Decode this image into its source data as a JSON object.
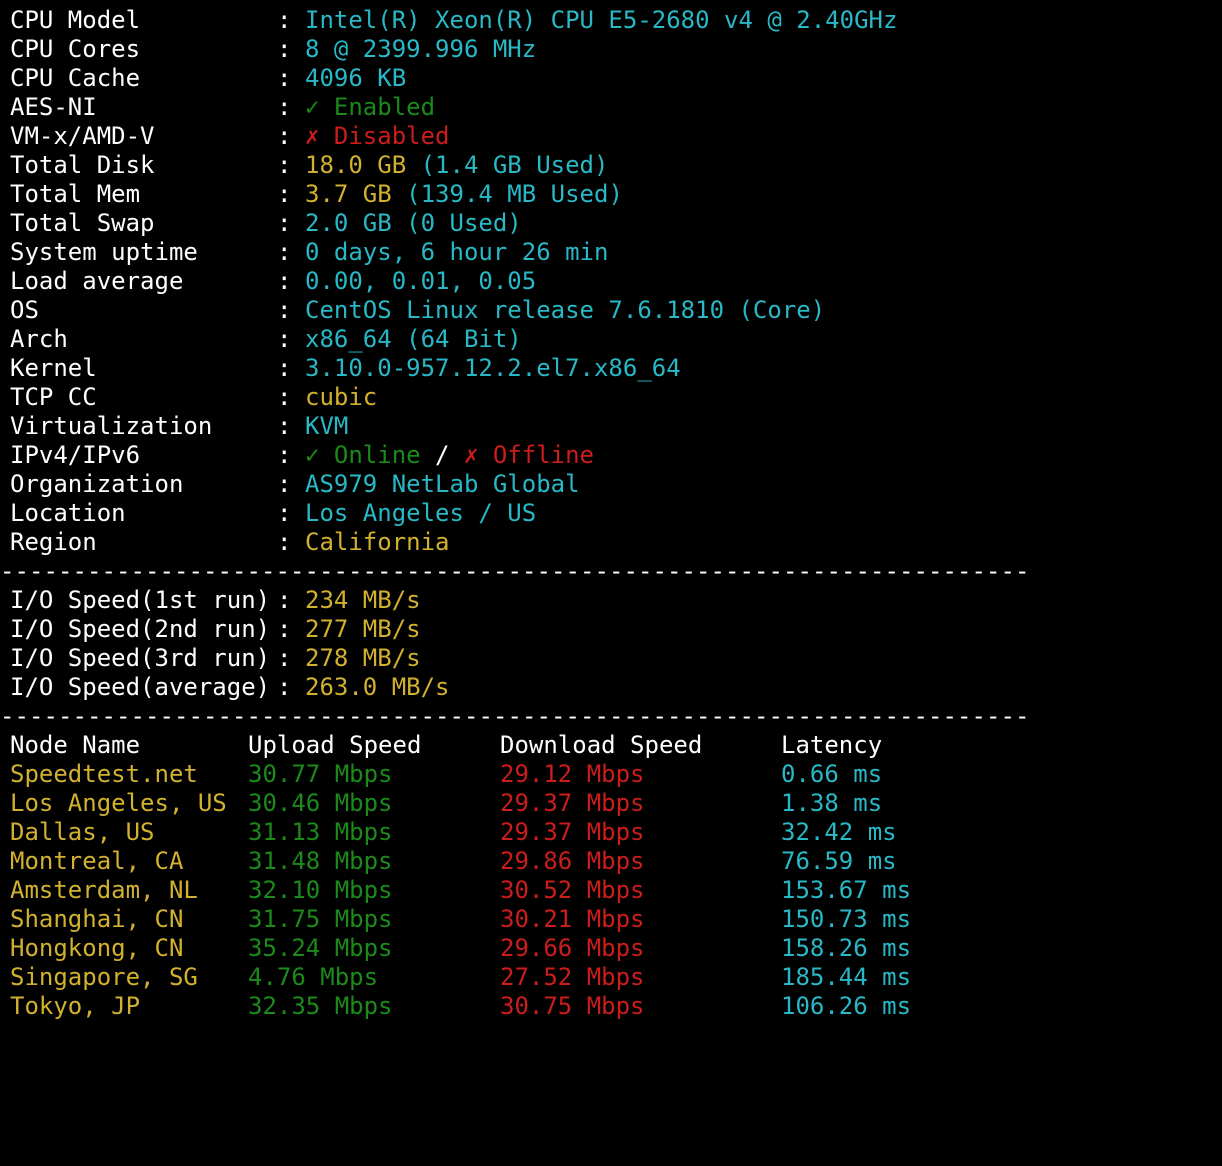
{
  "colors": {
    "background": "#000000",
    "label": "#ffffff",
    "cyan": "#29b8c6",
    "yellow": "#d1b12e",
    "green": "#1b8a1b",
    "red": "#cc1d1d"
  },
  "system_info": {
    "colon": ":",
    "rows": [
      {
        "label": "CPU Model",
        "value": "Intel(R) Xeon(R) CPU E5-2680 v4 @ 2.40GHz",
        "color": "cyan"
      },
      {
        "label": "CPU Cores",
        "value": "8 @ 2399.996 MHz",
        "color": "cyan"
      },
      {
        "label": "CPU Cache",
        "value": "4096 KB",
        "color": "cyan"
      },
      {
        "label": "AES-NI",
        "value": "✓ Enabled",
        "color": "green"
      },
      {
        "label": "VM-x/AMD-V",
        "value": "✗ Disabled",
        "color": "red"
      },
      {
        "label": "Total Disk",
        "value": "18.0 GB",
        "value_suffix": " (1.4 GB Used)",
        "color": "yellow",
        "suffix_color": "cyan"
      },
      {
        "label": "Total Mem",
        "value": "3.7 GB",
        "value_suffix": " (139.4 MB Used)",
        "color": "yellow",
        "suffix_color": "cyan"
      },
      {
        "label": "Total Swap",
        "value": "2.0 GB (0 Used)",
        "color": "cyan"
      },
      {
        "label": "System uptime",
        "value": "0 days, 6 hour 26 min",
        "color": "cyan"
      },
      {
        "label": "Load average",
        "value": "0.00, 0.01, 0.05",
        "color": "cyan"
      },
      {
        "label": "OS",
        "value": "CentOS Linux release 7.6.1810 (Core)",
        "color": "cyan"
      },
      {
        "label": "Arch",
        "value": "x86_64 (64 Bit)",
        "color": "cyan"
      },
      {
        "label": "Kernel",
        "value": "3.10.0-957.12.2.el7.x86_64",
        "color": "cyan"
      },
      {
        "label": "TCP CC",
        "value": "cubic",
        "color": "yellow"
      },
      {
        "label": "Virtualization",
        "value": "KVM",
        "color": "cyan"
      },
      {
        "label": "IPv4/IPv6",
        "value": "✓ Online",
        "mid": " / ",
        "value_suffix": "✗ Offline",
        "color": "green",
        "mid_color": "white",
        "suffix_color": "red"
      },
      {
        "label": "Organization",
        "value": "AS979 NetLab Global",
        "color": "cyan"
      },
      {
        "label": "Location",
        "value": "Los Angeles / US",
        "color": "cyan"
      },
      {
        "label": "Region",
        "value": "California",
        "color": "yellow"
      }
    ]
  },
  "separator": "-----------------------------------------------------------------------",
  "io_speed": {
    "rows": [
      {
        "label": "I/O Speed(1st run)",
        "value": "234 MB/s"
      },
      {
        "label": "I/O Speed(2nd run)",
        "value": "277 MB/s"
      },
      {
        "label": "I/O Speed(3rd run)",
        "value": "278 MB/s"
      },
      {
        "label": "I/O Speed(average)",
        "value": "263.0 MB/s"
      }
    ]
  },
  "speedtest": {
    "headers": {
      "node": "Node Name",
      "upload": "Upload Speed",
      "download": "Download Speed",
      "latency": "Latency"
    },
    "rows": [
      {
        "node": "Speedtest.net",
        "upload": "30.77 Mbps",
        "download": "29.12 Mbps",
        "latency": "0.66 ms"
      },
      {
        "node": "Los Angeles, US",
        "upload": "30.46 Mbps",
        "download": "29.37 Mbps",
        "latency": "1.38 ms"
      },
      {
        "node": "Dallas, US",
        "upload": "31.13 Mbps",
        "download": "29.37 Mbps",
        "latency": "32.42 ms"
      },
      {
        "node": "Montreal, CA",
        "upload": "31.48 Mbps",
        "download": "29.86 Mbps",
        "latency": "76.59 ms"
      },
      {
        "node": "Amsterdam, NL",
        "upload": "32.10 Mbps",
        "download": "30.52 Mbps",
        "latency": "153.67 ms"
      },
      {
        "node": "Shanghai, CN",
        "upload": "31.75 Mbps",
        "download": "30.21 Mbps",
        "latency": "150.73 ms"
      },
      {
        "node": "Hongkong, CN",
        "upload": "35.24 Mbps",
        "download": "29.66 Mbps",
        "latency": "158.26 ms"
      },
      {
        "node": "Singapore, SG",
        "upload": "4.76 Mbps",
        "download": "27.52 Mbps",
        "latency": "185.44 ms"
      },
      {
        "node": "Tokyo, JP",
        "upload": "32.35 Mbps",
        "download": "30.75 Mbps",
        "latency": "106.26 ms"
      }
    ]
  }
}
